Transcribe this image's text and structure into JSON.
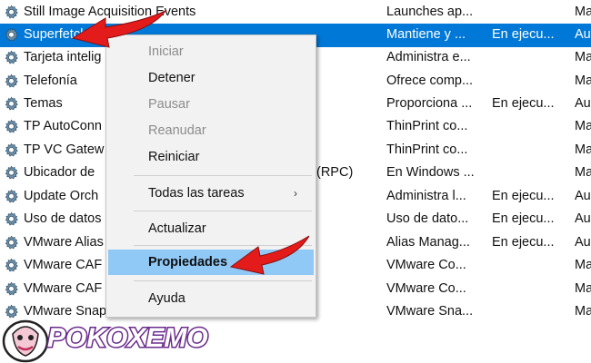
{
  "services": [
    {
      "name": "Still Image Acquisition Events",
      "desc": "Launches ap...",
      "status": "",
      "start": "Ma"
    },
    {
      "name": "Superfetch",
      "desc": "Mantiene y ...",
      "status": "En ejecu...",
      "start": "Au",
      "selected": true
    },
    {
      "name": "Tarjeta intelig",
      "desc": "Administra e...",
      "status": "",
      "start": "Ma"
    },
    {
      "name": "Telefonía",
      "desc": "Ofrece comp...",
      "status": "",
      "start": "Ma"
    },
    {
      "name": "Temas",
      "desc": "Proporciona ...",
      "status": "En ejecu...",
      "start": "Au"
    },
    {
      "name": "TP AutoConn",
      "desc": "ThinPrint co...",
      "status": "",
      "start": "Ma"
    },
    {
      "name": "TP VC Gatew",
      "desc": "ThinPrint co...",
      "status": "",
      "start": "Ma"
    },
    {
      "name": "Ubicador de",
      "desc": "En Windows ...",
      "status": "",
      "start": "Ma",
      "suffix": "(RPC)"
    },
    {
      "name": "Update Orch",
      "desc": "Administra l...",
      "status": "En ejecu...",
      "start": "Au"
    },
    {
      "name": "Uso de datos",
      "desc": "Uso de dato...",
      "status": "En ejecu...",
      "start": "Au"
    },
    {
      "name": "VMware Alias",
      "desc": "Alias Manag...",
      "status": "En ejecu...",
      "start": "Au"
    },
    {
      "name": "VMware CAF",
      "desc": "VMware Co...",
      "status": "",
      "start": "Ma"
    },
    {
      "name": "VMware CAF",
      "desc": "VMware Co...",
      "status": "",
      "start": "Ma"
    },
    {
      "name": "VMware Snapshot Provider",
      "desc": "VMware Sna...",
      "status": "",
      "start": "Ma"
    }
  ],
  "context_menu": {
    "items": [
      {
        "label": "Iniciar",
        "state": "disabled"
      },
      {
        "label": "Detener",
        "state": "enabled"
      },
      {
        "label": "Pausar",
        "state": "disabled"
      },
      {
        "label": "Reanudar",
        "state": "disabled"
      },
      {
        "label": "Reiniciar",
        "state": "enabled"
      },
      {
        "label": "Todas las tareas",
        "state": "enabled",
        "submenu": true
      },
      {
        "label": "Actualizar",
        "state": "enabled"
      },
      {
        "label": "Propiedades",
        "state": "highlighted"
      },
      {
        "label": "Ayuda",
        "state": "enabled"
      }
    ],
    "submenu_glyph": "›"
  },
  "watermark": {
    "text": "POKOXEMO"
  },
  "colors": {
    "selection": "#0078d7",
    "menu_hover": "#90c8f6",
    "arrow": "#e41b1b"
  },
  "icons": {
    "service": "gear-icon",
    "annotation": "red-arrow-icon"
  }
}
